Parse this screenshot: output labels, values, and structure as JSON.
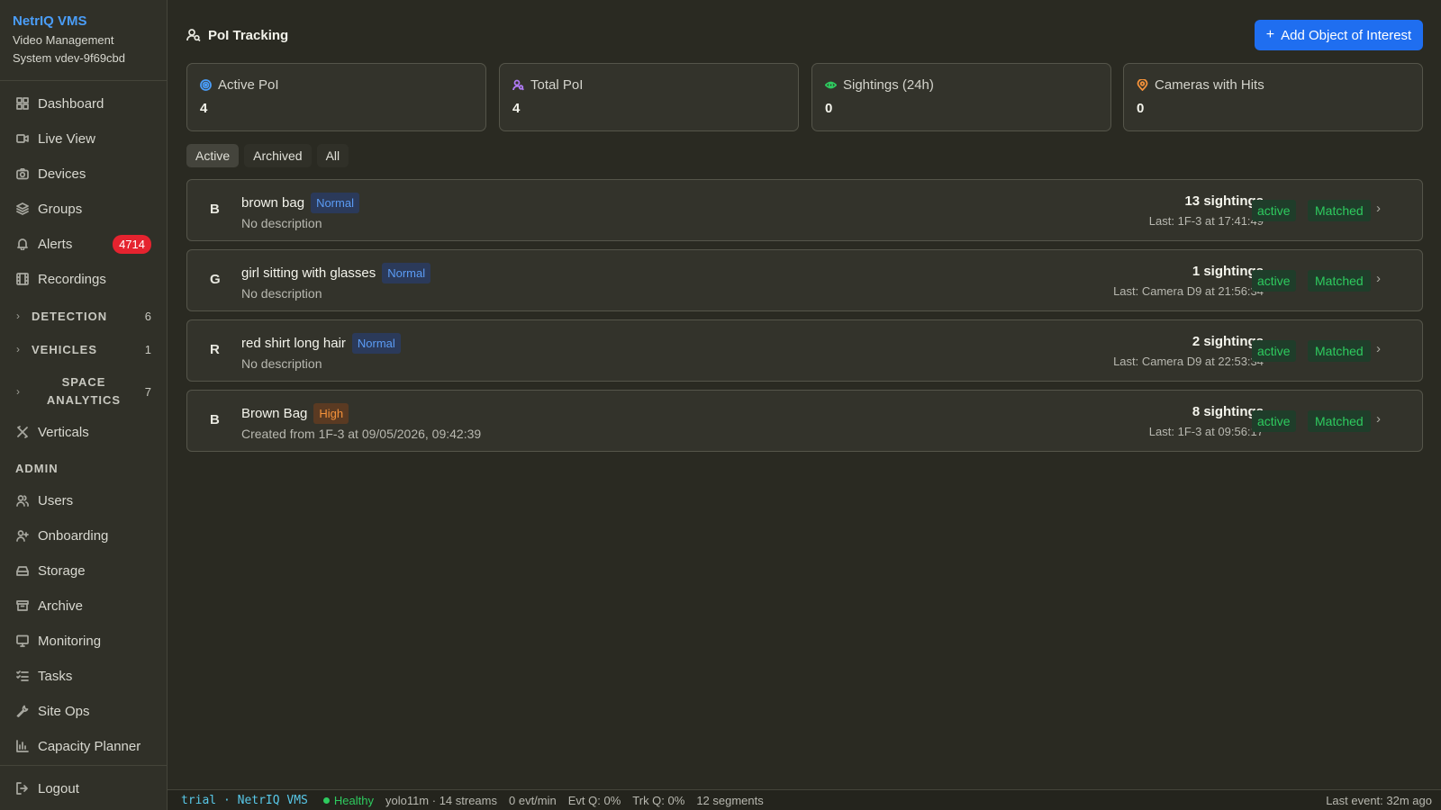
{
  "brand": {
    "name": "NetrIQ VMS",
    "subtitle": "Video Management System vdev-9f69cbd"
  },
  "nav": {
    "dashboard": "Dashboard",
    "live_view": "Live View",
    "devices": "Devices",
    "groups": "Groups",
    "alerts": "Alerts",
    "alerts_badge": "4714",
    "recordings": "Recordings",
    "detection": "DETECTION",
    "detection_count": "6",
    "vehicles": "VEHICLES",
    "vehicles_count": "1",
    "space_analytics": "SPACE ANALYTICS",
    "space_analytics_count": "7",
    "verticals": "Verticals",
    "admin": "ADMIN",
    "users": "Users",
    "onboarding": "Onboarding",
    "storage": "Storage",
    "archive": "Archive",
    "monitoring": "Monitoring",
    "tasks": "Tasks",
    "site_ops": "Site Ops",
    "capacity_planner": "Capacity Planner",
    "logout": "Logout"
  },
  "header": {
    "title": "PoI Tracking",
    "add_button": "Add Object of Interest"
  },
  "stats": [
    {
      "label": "Active PoI",
      "value": "4",
      "icon": "target-icon",
      "color": "#4a9df8"
    },
    {
      "label": "Total PoI",
      "value": "4",
      "icon": "user-search-icon",
      "color": "#b07af5"
    },
    {
      "label": "Sightings (24h)",
      "value": "0",
      "icon": "eye-icon",
      "color": "#2ecb5f"
    },
    {
      "label": "Cameras with Hits",
      "value": "0",
      "icon": "map-pin-icon",
      "color": "#f5923a"
    }
  ],
  "tabs": [
    "Active",
    "Archived",
    "All"
  ],
  "items": [
    {
      "letter": "B",
      "name": "brown bag",
      "priority": "Normal",
      "description": "No description",
      "sightings": "13 sightings",
      "last": "Last: 1F-3 at 17:41:49",
      "status": "active",
      "match": "Matched"
    },
    {
      "letter": "G",
      "name": "girl sitting with glasses",
      "priority": "Normal",
      "description": "No description",
      "sightings": "1 sightings",
      "last": "Last: Camera D9 at 21:56:34",
      "status": "active",
      "match": "Matched"
    },
    {
      "letter": "R",
      "name": "red shirt long hair",
      "priority": "Normal",
      "description": "No description",
      "sightings": "2 sightings",
      "last": "Last: Camera D9 at 22:53:34",
      "status": "active",
      "match": "Matched"
    },
    {
      "letter": "B",
      "name": "Brown Bag",
      "priority": "High",
      "description": "Created from 1F-3 at 09/05/2026, 09:42:39",
      "sightings": "8 sightings",
      "last": "Last: 1F-3 at 09:56:17",
      "status": "active",
      "match": "Matched"
    }
  ],
  "statusbar": {
    "trial": "trial · NetrIQ VMS",
    "health": "Healthy",
    "model": "yolo11m · 14 streams",
    "rate": "0 evt/min",
    "evt_q": "Evt Q: 0%",
    "trk_q": "Trk Q: 0%",
    "segments": "12 segments",
    "last_event": "Last event: 32m ago"
  }
}
